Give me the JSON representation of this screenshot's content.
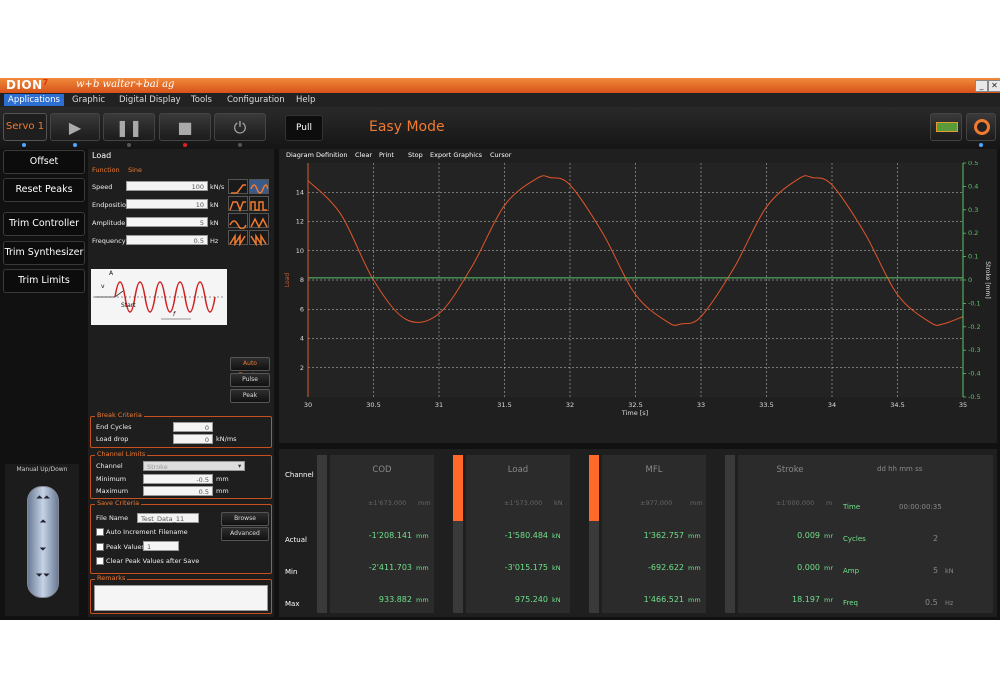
{
  "window": {
    "logo": "DION",
    "logo_mark": "7",
    "brand": "w+b  walter+bai ag"
  },
  "menu": [
    "Applications",
    "Graphic",
    "Digital Display",
    "Tools",
    "Configuration",
    "Help"
  ],
  "toolbar": {
    "servo": "Servo 1",
    "pull": "Pull",
    "mode": "Easy Mode"
  },
  "left_buttons": [
    "Offset",
    "Reset Peaks",
    "Trim Controller",
    "Trim Synthesizer",
    "Trim Limits"
  ],
  "manual": {
    "label": "Manual Up/Down"
  },
  "load_panel": {
    "title": "Load",
    "function_label": "Function",
    "function_value": "Sine",
    "params": [
      {
        "label": "Speed",
        "value": "100",
        "unit": "kN/s"
      },
      {
        "label": "Endposition",
        "value": "10",
        "unit": "kN"
      },
      {
        "label": "Amplitude",
        "value": "5",
        "unit": "kN"
      },
      {
        "label": "Frequency",
        "value": "0.5",
        "unit": "Hz"
      }
    ],
    "diagram_labels": {
      "a": "A",
      "v": "v",
      "start": "Start",
      "f": "f"
    },
    "side_buttons": [
      "Auto Zeroing",
      "Pulse",
      "Peak"
    ]
  },
  "break_criteria": {
    "title": "Break Criteria",
    "rows": [
      {
        "label": "End Cycles",
        "value": "0",
        "unit": ""
      },
      {
        "label": "Load drop",
        "value": "0",
        "unit": "kN/ms"
      }
    ]
  },
  "channel_limits": {
    "title": "Channel Limits",
    "channel_label": "Channel",
    "channel_value": "Stroke",
    "rows": [
      {
        "label": "Minimum",
        "value": "-0.5",
        "unit": "mm"
      },
      {
        "label": "Maximum",
        "value": "0.5",
        "unit": "mm"
      }
    ]
  },
  "save_criteria": {
    "title": "Save Criteria",
    "file_label": "File Name",
    "file_value": "Test_Data_11",
    "browse": "Browse",
    "advanced": "Advanced",
    "auto_increment": "Auto Increment Filename",
    "peak_values": "Peak Values",
    "peak_values_count": "1",
    "clear_peaks": "Clear Peak Values after Save"
  },
  "remarks": {
    "title": "Remarks"
  },
  "chart_menu": [
    "Diagram Definition",
    "Clear",
    "Print",
    "Stop",
    "Export Graphics",
    "Cursor"
  ],
  "chart_data": {
    "type": "line",
    "xlabel": "Time [s]",
    "ylabel": "Load",
    "y2label": "Stroke [mm]",
    "xlim": [
      30,
      35
    ],
    "ylim": [
      0,
      16
    ],
    "y2lim": [
      -0.5,
      0.5
    ],
    "xticks": [
      30,
      30.5,
      31,
      31.5,
      32,
      32.5,
      33,
      33.5,
      34,
      34.5,
      35
    ],
    "yticks": [
      2,
      4,
      6,
      8,
      10,
      12,
      14
    ],
    "y2ticks": [
      0.5,
      0.4,
      0.3,
      0.2,
      0.1,
      0,
      -0.1,
      -0.2,
      -0.3,
      -0.4,
      -0.5
    ],
    "grid": true,
    "series": [
      {
        "color": "#e0552a",
        "x": [
          30,
          30.25,
          30.5,
          30.75,
          31,
          31.25,
          31.5,
          31.75,
          31.85,
          32,
          32.25,
          32.5,
          32.75,
          32.85,
          33,
          33.25,
          33.5,
          33.75,
          33.85,
          34,
          34.25,
          34.5,
          34.75,
          34.85,
          35
        ],
        "y": [
          14.8,
          12.5,
          8.0,
          5.3,
          5.7,
          8.9,
          13.1,
          14.96,
          15.0,
          14.5,
          11.2,
          7.0,
          5.1,
          5.0,
          5.5,
          8.8,
          13.0,
          14.95,
          15.0,
          14.5,
          11.2,
          7.0,
          5.1,
          5.0,
          5.5
        ]
      },
      {
        "color": "#59c46a",
        "axis": "right",
        "x": [
          30,
          35
        ],
        "y": [
          0.009,
          0.009
        ]
      }
    ]
  },
  "display": {
    "channel_header": "Channel",
    "row_labels": [
      "Actual",
      "Min",
      "Max"
    ],
    "channels": [
      {
        "name": "COD",
        "range": "±1'673.000",
        "range_unit": "mm",
        "actual": "-1'208.141",
        "min": "-2'411.703",
        "max": "933.882",
        "unit": "mm",
        "bar_level": 0
      },
      {
        "name": "Load",
        "range": "±1'573.000",
        "range_unit": "kN",
        "actual": "-1'580.484",
        "min": "-3'015.175",
        "max": "975.240",
        "unit": "kN",
        "bar_level": 0.42
      },
      {
        "name": "MFL",
        "range": "±977.000",
        "range_unit": "mm",
        "actual": "1'362.757",
        "min": "-692.622",
        "max": "1'466.521",
        "unit": "mm",
        "bar_level": 0.42
      },
      {
        "name": "Stroke",
        "range": "±1'000.000",
        "range_unit": "mm",
        "actual": "0.009",
        "min": "0.000",
        "max": "18.197",
        "unit": "mm",
        "bar_level": 0
      }
    ],
    "timing": {
      "header": "dd hh mm ss",
      "rows": [
        {
          "label": "Time",
          "value": "00:00:00:35",
          "unit": ""
        },
        {
          "label": "Cycles",
          "value": "2",
          "unit": ""
        },
        {
          "label": "Amp",
          "value": "5",
          "unit": "kN"
        },
        {
          "label": "Freq",
          "value": "0.5",
          "unit": "Hz"
        }
      ]
    }
  },
  "colors": {
    "accent": "#f07a30",
    "value_green": "#6fe08a",
    "bar_orange": "#ff6a2a",
    "menu_active": "#2d6fd1"
  }
}
